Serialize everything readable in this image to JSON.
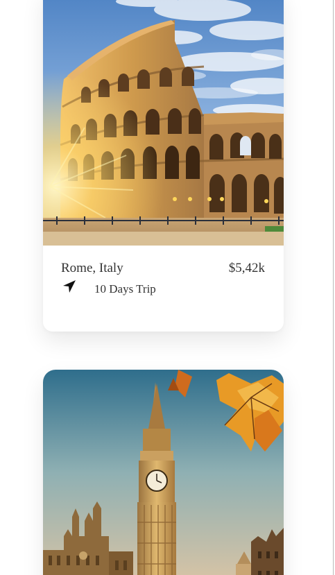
{
  "destinations": [
    {
      "image": "colosseum-photo",
      "place": "Rome, Italy",
      "price": "$5,42k",
      "icon": "navigation-arrow-icon",
      "duration": "10 Days Trip"
    },
    {
      "image": "big-ben-photo"
    }
  ],
  "colors": {
    "text": "#333333",
    "card_background": "#ffffff"
  }
}
